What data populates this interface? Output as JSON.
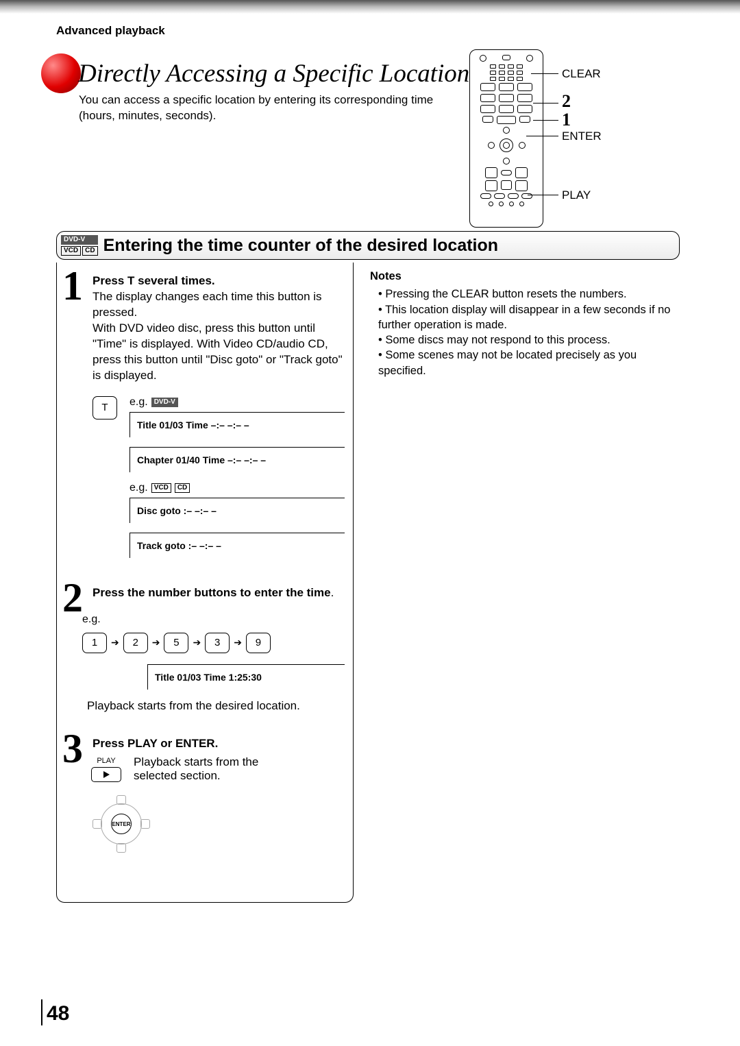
{
  "header": {
    "section_label": "Advanced playback"
  },
  "title": "Directly Accessing a Specific Location",
  "intro": "You can access a specific location by entering its corresponding time (hours, minutes, seconds).",
  "remote_labels": {
    "clear": "CLEAR",
    "num2": "2",
    "num1": "1",
    "enter": "ENTER",
    "play": "PLAY"
  },
  "section": {
    "badges": {
      "dvdv": "DVD-V",
      "vcd": "VCD",
      "cd": "CD"
    },
    "title": "Entering the time counter of the desired location"
  },
  "steps": {
    "s1": {
      "num": "1",
      "heading": "Press T several times.",
      "body1": "The display changes each time this button is pressed.",
      "body2": "With DVD video disc, press this button until \"Time\" is displayed. With Video CD/audio CD, press this button until \"Disc goto\" or \"Track goto\" is displayed.",
      "t_key": "T",
      "eg1_prefix": "e.g.",
      "eg1_badge": "DVD-V",
      "disp1": "Title  01/03   Time   –:– –:– –",
      "disp2": "Chapter  01/40   Time   –:– –:– –",
      "eg2_prefix": "e.g.",
      "eg2_badge1": "VCD",
      "eg2_badge2": "CD",
      "disp3": "Disc goto :– –:– –",
      "disp4": "Track goto :– –:– –"
    },
    "s2": {
      "num": "2",
      "heading": "Press the number buttons to enter the time",
      "heading_suffix": ".",
      "eg": "e.g.",
      "keys": [
        "1",
        "2",
        "5",
        "3",
        "9"
      ],
      "disp": "Title  01/03   Time   1:25:30",
      "body": "Playback starts from the desired location."
    },
    "s3": {
      "num": "3",
      "heading": "Press PLAY or ENTER.",
      "play_small": "PLAY",
      "body": "Playback starts from the selected section.",
      "enter_label": "ENTER"
    }
  },
  "notes": {
    "heading": "Notes",
    "items": [
      "Pressing the CLEAR button resets the numbers.",
      "This location display will disappear in a few seconds if no further operation is made.",
      "Some discs may not respond to this process.",
      "Some scenes may not be located precisely as you specified."
    ]
  },
  "page_number": "48"
}
